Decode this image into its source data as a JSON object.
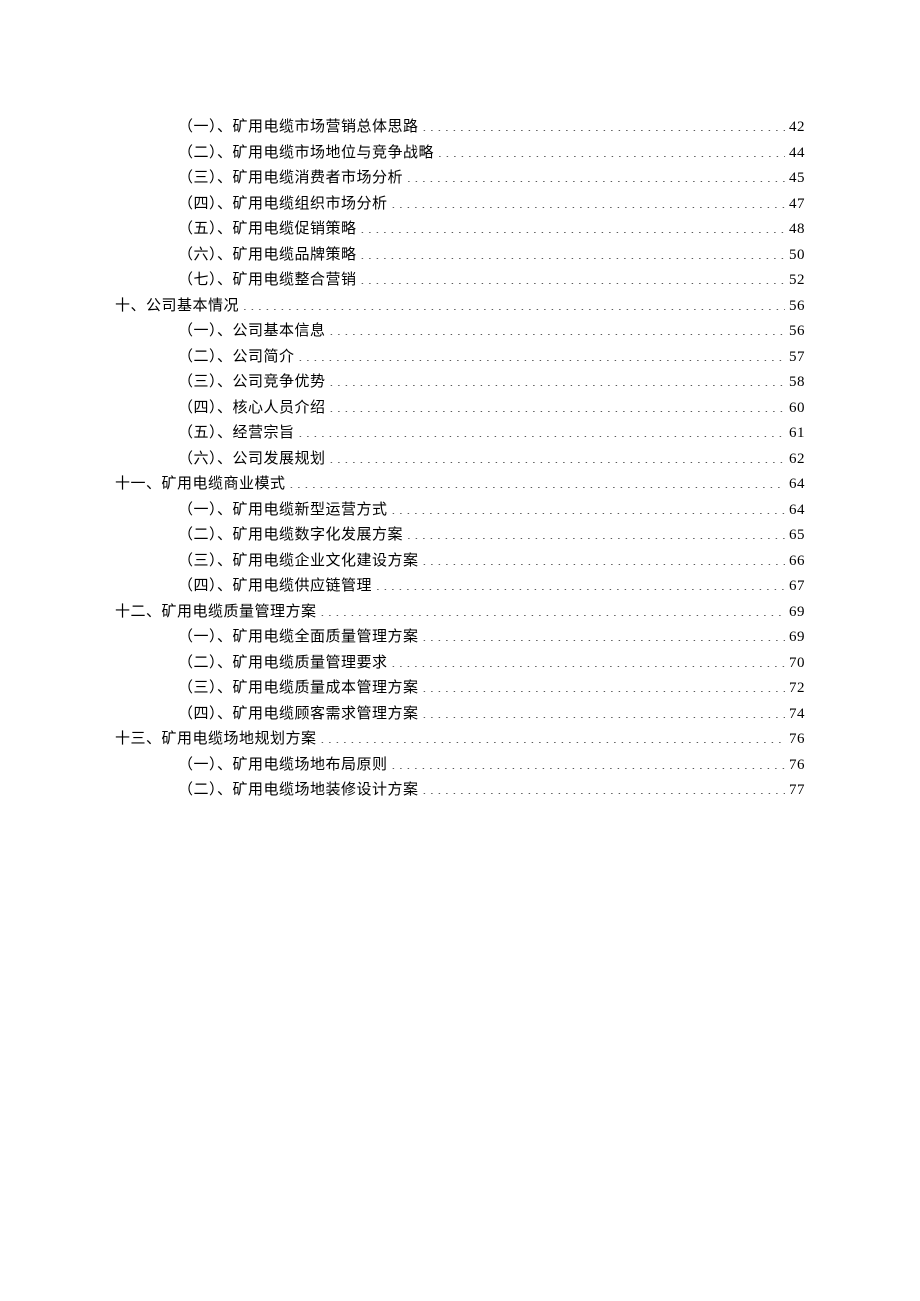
{
  "toc": [
    {
      "level": 2,
      "label": "（一）、矿用电缆市场营销总体思路",
      "page": "42"
    },
    {
      "level": 2,
      "label": "（二）、矿用电缆市场地位与竞争战略",
      "page": "44"
    },
    {
      "level": 2,
      "label": "（三）、矿用电缆消费者市场分析",
      "page": "45"
    },
    {
      "level": 2,
      "label": "（四）、矿用电缆组织市场分析",
      "page": "47"
    },
    {
      "level": 2,
      "label": "（五）、矿用电缆促销策略",
      "page": "48"
    },
    {
      "level": 2,
      "label": "（六）、矿用电缆品牌策略",
      "page": "50"
    },
    {
      "level": 2,
      "label": "（七）、矿用电缆整合营销",
      "page": "52"
    },
    {
      "level": 1,
      "label": "十、公司基本情况",
      "page": "56"
    },
    {
      "level": 2,
      "label": "（一）、公司基本信息",
      "page": "56"
    },
    {
      "level": 2,
      "label": "（二）、公司简介",
      "page": "57"
    },
    {
      "level": 2,
      "label": "（三）、公司竞争优势",
      "page": "58"
    },
    {
      "level": 2,
      "label": "（四）、核心人员介绍",
      "page": "60"
    },
    {
      "level": 2,
      "label": "（五）、经营宗旨",
      "page": "61"
    },
    {
      "level": 2,
      "label": "（六）、公司发展规划",
      "page": "62"
    },
    {
      "level": 1,
      "label": "十一、矿用电缆商业模式",
      "page": "64"
    },
    {
      "level": 2,
      "label": "（一）、矿用电缆新型运营方式",
      "page": "64"
    },
    {
      "level": 2,
      "label": "（二）、矿用电缆数字化发展方案",
      "page": "65"
    },
    {
      "level": 2,
      "label": "（三）、矿用电缆企业文化建设方案",
      "page": "66"
    },
    {
      "level": 2,
      "label": "（四）、矿用电缆供应链管理",
      "page": "67"
    },
    {
      "level": 1,
      "label": "十二、矿用电缆质量管理方案",
      "page": "69"
    },
    {
      "level": 2,
      "label": "（一）、矿用电缆全面质量管理方案",
      "page": "69"
    },
    {
      "level": 2,
      "label": "（二）、矿用电缆质量管理要求",
      "page": "70"
    },
    {
      "level": 2,
      "label": "（三）、矿用电缆质量成本管理方案",
      "page": "72"
    },
    {
      "level": 2,
      "label": "（四）、矿用电缆顾客需求管理方案",
      "page": "74"
    },
    {
      "level": 1,
      "label": "十三、矿用电缆场地规划方案",
      "page": "76"
    },
    {
      "level": 2,
      "label": "（一）、矿用电缆场地布局原则",
      "page": "76"
    },
    {
      "level": 2,
      "label": "（二）、矿用电缆场地装修设计方案",
      "page": "77"
    }
  ]
}
